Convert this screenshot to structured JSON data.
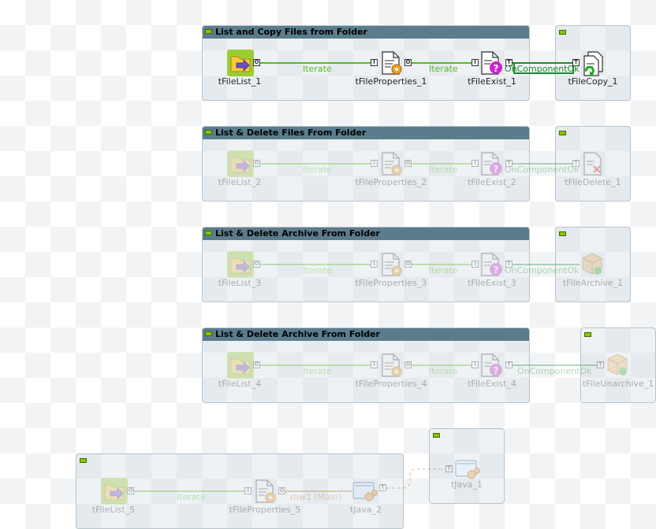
{
  "colors": {
    "subjob_header": "#5b7c8d",
    "iterate_link": "#55bb22",
    "oncomponentok_link": "#1f8a2f",
    "row_link": "#b07a3a",
    "toggle": "#8bc400"
  },
  "subjobs": [
    {
      "title": "List and Copy Files from Folder",
      "components": [
        "tFileList_1",
        "tFileProperties_1",
        "tFileExist_1",
        "tFileCopy_1"
      ],
      "links": [
        "Iterate",
        "Iterate",
        "OnComponentOk"
      ],
      "active": true
    },
    {
      "title": "List & Delete Files From Folder",
      "components": [
        "tFileList_2",
        "tFileProperties_2",
        "tFileExist_2",
        "tFileDelete_1"
      ],
      "links": [
        "Iterate",
        "Iterate",
        "OnComponentOk"
      ],
      "active": false
    },
    {
      "title": "List & Delete Archive From Folder",
      "components": [
        "tFileList_3",
        "tFileProperties_3",
        "tFileExist_3",
        "tFileArchive_1"
      ],
      "links": [
        "Iterate",
        "Iterate",
        "OnComponentOk"
      ],
      "active": false
    },
    {
      "title": "List & Delete Archive From Folder",
      "components": [
        "tFileList_4",
        "tFileProperties_4",
        "tFileExist_4",
        "tFileUnarchive_1"
      ],
      "links": [
        "Iterate",
        "Iterate",
        "OnComponentOk"
      ],
      "active": false
    },
    {
      "title": "",
      "components": [
        "tFileList_5",
        "tFileProperties_5",
        "tJava_2",
        "tJava_1"
      ],
      "links": [
        "Iterate",
        "row1 (Main)"
      ],
      "active": false
    }
  ],
  "icons": {
    "file_list": "folder-list-icon",
    "file_properties": "file-properties-icon",
    "file_exist": "file-exist-icon",
    "file_copy": "file-copy-icon",
    "file_delete": "file-delete-icon",
    "file_archive": "file-archive-icon",
    "file_unarchive": "file-unarchive-icon",
    "java": "java-icon"
  },
  "ports": {
    "iterate_out": "O",
    "iterate_in": "I",
    "trigger": "T"
  }
}
